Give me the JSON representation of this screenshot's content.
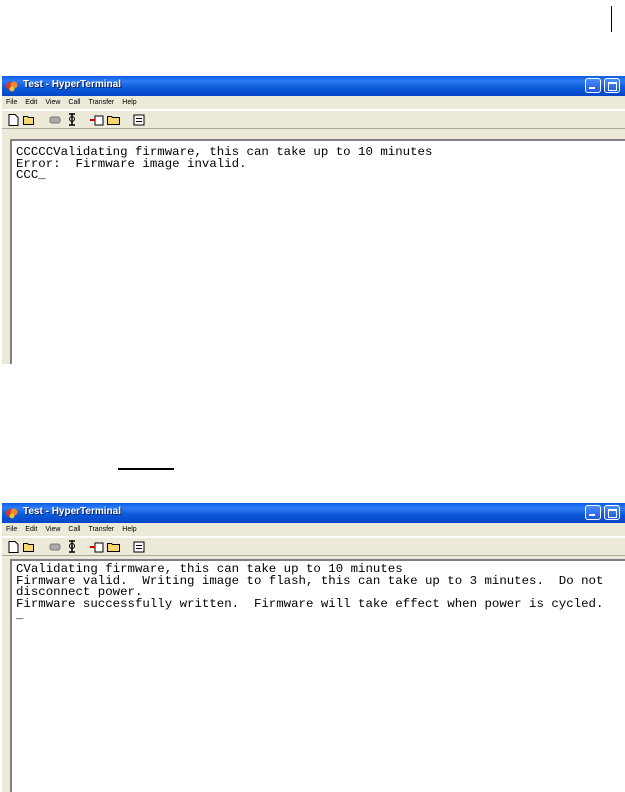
{
  "windows": [
    {
      "title": "Test - HyperTerminal",
      "menu": [
        "File",
        "Edit",
        "View",
        "Call",
        "Transfer",
        "Help"
      ],
      "toolbar_icons": [
        "new-icon",
        "open-icon",
        "connect-icon",
        "disconnect-icon",
        "send-icon",
        "receive-icon",
        "properties-icon"
      ],
      "terminal_lines": [
        "CCCCCValidating firmware, this can take up to 10 minutes",
        "Error:  Firmware image invalid.",
        "CCC_"
      ]
    },
    {
      "title": "Test - HyperTerminal",
      "menu": [
        "File",
        "Edit",
        "View",
        "Call",
        "Transfer",
        "Help"
      ],
      "toolbar_icons": [
        "new-icon",
        "open-icon",
        "connect-icon",
        "disconnect-icon",
        "send-icon",
        "receive-icon",
        "properties-icon"
      ],
      "terminal_lines": [
        "CValidating firmware, this can take up to 10 minutes",
        "Firmware valid.  Writing image to flash, this can take up to 3 minutes.  Do not",
        "disconnect power.",
        "Firmware successfully written.  Firmware will take effect when power is cycled.",
        "_"
      ]
    }
  ]
}
